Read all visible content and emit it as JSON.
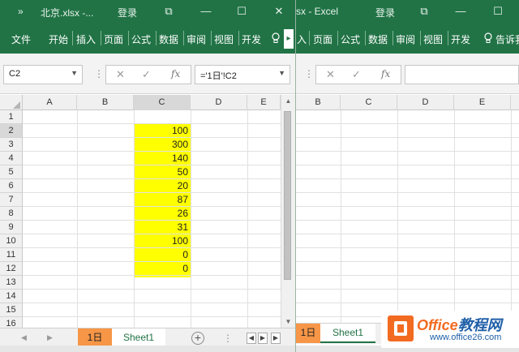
{
  "left_window": {
    "title_dots": "»",
    "title": "北京.xlsx  -...",
    "login": "登录",
    "controls": [
      "⧉",
      "—",
      "☐",
      "✕"
    ],
    "tabs": [
      "文件",
      "开始",
      "插入",
      "页面",
      "公式",
      "数据",
      "审阅",
      "视图",
      "开发"
    ],
    "ribbon_more": "▸",
    "name_box": "C2",
    "formula": "='1日'!C2",
    "fx_cancel": "✕",
    "fx_enter": "✓",
    "fx_label": "fx",
    "columns": [
      "A",
      "B",
      "C",
      "D",
      "E"
    ],
    "rows": [
      "1",
      "2",
      "3",
      "4",
      "5",
      "6",
      "7",
      "8",
      "9",
      "10",
      "11",
      "12",
      "13",
      "14",
      "15",
      "16"
    ],
    "c_values": [
      "",
      "100",
      "300",
      "140",
      "50",
      "20",
      "87",
      "26",
      "31",
      "100",
      "0",
      "0"
    ],
    "highlight_color": "#ffff00",
    "sheet_tabs": [
      "1日",
      "Sheet1"
    ],
    "add_sheet": "+"
  },
  "right_window": {
    "title": "sx  -  Excel",
    "login": "登录",
    "controls": [
      "⧉",
      "—",
      "☐"
    ],
    "tabs": [
      "入",
      "页面",
      "公式",
      "数据",
      "审阅",
      "视图",
      "开发",
      "告诉我"
    ],
    "tell_icon": "lightbulb-icon",
    "fx_cancel": "✕",
    "fx_enter": "✓",
    "fx_label": "fx",
    "columns": [
      "B",
      "C",
      "D",
      "E"
    ],
    "sheet_tabs": [
      "1日",
      "Sheet1"
    ]
  },
  "watermark": {
    "brand_a": "Office",
    "brand_b": "教程网",
    "url": "www.office26.com"
  },
  "colors": {
    "excel_green": "#217346",
    "tab_orange": "#f79646",
    "brand_orange": "#f26b21"
  }
}
